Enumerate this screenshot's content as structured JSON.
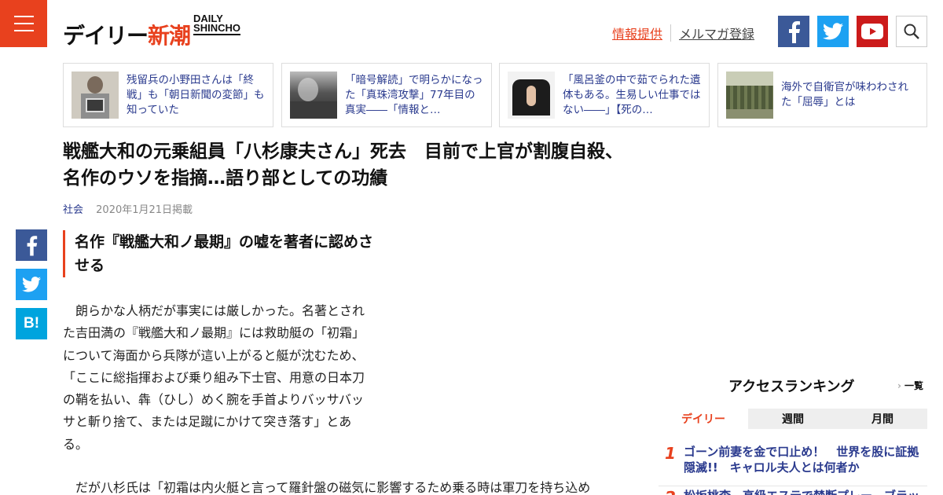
{
  "header": {
    "logo_ja_black": "デイリー",
    "logo_ja_red": "新潮",
    "logo_en_line1": "DAILY",
    "logo_en_line2": "SHINCHO",
    "link_info": "情報提供",
    "link_mag": "メルマガ登録",
    "icons": [
      "facebook-icon",
      "twitter-icon",
      "youtube-icon",
      "search-icon"
    ]
  },
  "related": [
    {
      "text": "残留兵の小野田さんは「終戦」も「朝日新聞の変節」も知っていた"
    },
    {
      "text": "「暗号解読」で明らかになった「真珠湾攻撃」77年目の真実――「情報と…"
    },
    {
      "text": "「風呂釜の中で茹でられた遺体もある。生易しい仕事ではない――」【死の…"
    },
    {
      "text": "海外で自衛官が味わわされた「屈辱」とは"
    }
  ],
  "article": {
    "title": "戦艦大和の元乗組員「八杉康夫さん」死去　目前で上官が割腹自殺、名作のウソを指摘…語り部としての功績",
    "category": "社会",
    "date": "2020年1月21日掲載",
    "subhead": "名作『戦艦大和ノ最期』の嘘を著者に認めさせる",
    "paragraph1": "朗らかな人柄だが事実には厳しかった。名著とされた吉田満の『戦艦大和ノ最期』には救助艇の「初霜」について海面から兵隊が這い上がると艇が沈むため、「ここに総指揮および乗り組み下士官、用意の日本刀の鞘を払い、犇（ひし）めく腕を手首よりバッサバッサと斬り捨て、または足蹴にかけて突き落す」とある。",
    "paragraph2": "だが八杉氏は「初霜は内火艇と言って羅針盤の磁気に影響するため乗る時は軍刀を持ち込め"
  },
  "share": {
    "facebook": "f",
    "twitter": "t",
    "hatena": "B!"
  },
  "ranking": {
    "title": "アクセスランキング",
    "more": "一覧",
    "tabs": [
      "デイリー",
      "週間",
      "月間"
    ],
    "items": [
      {
        "rank": "1",
        "text": "ゴーン前妻を金で口止め！　世界を股に証拠隠滅!!　キャロル夫人とは何者か"
      },
      {
        "rank": "2",
        "text": "松坂桃李、高級エステで禁断プレー　ブラックリ"
      }
    ]
  },
  "colors": {
    "accent": "#e8411e",
    "link": "#2a3a8e",
    "facebook": "#3b5998",
    "twitter": "#1da1f2",
    "youtube": "#cc1b1b",
    "hatena": "#00a4de"
  }
}
